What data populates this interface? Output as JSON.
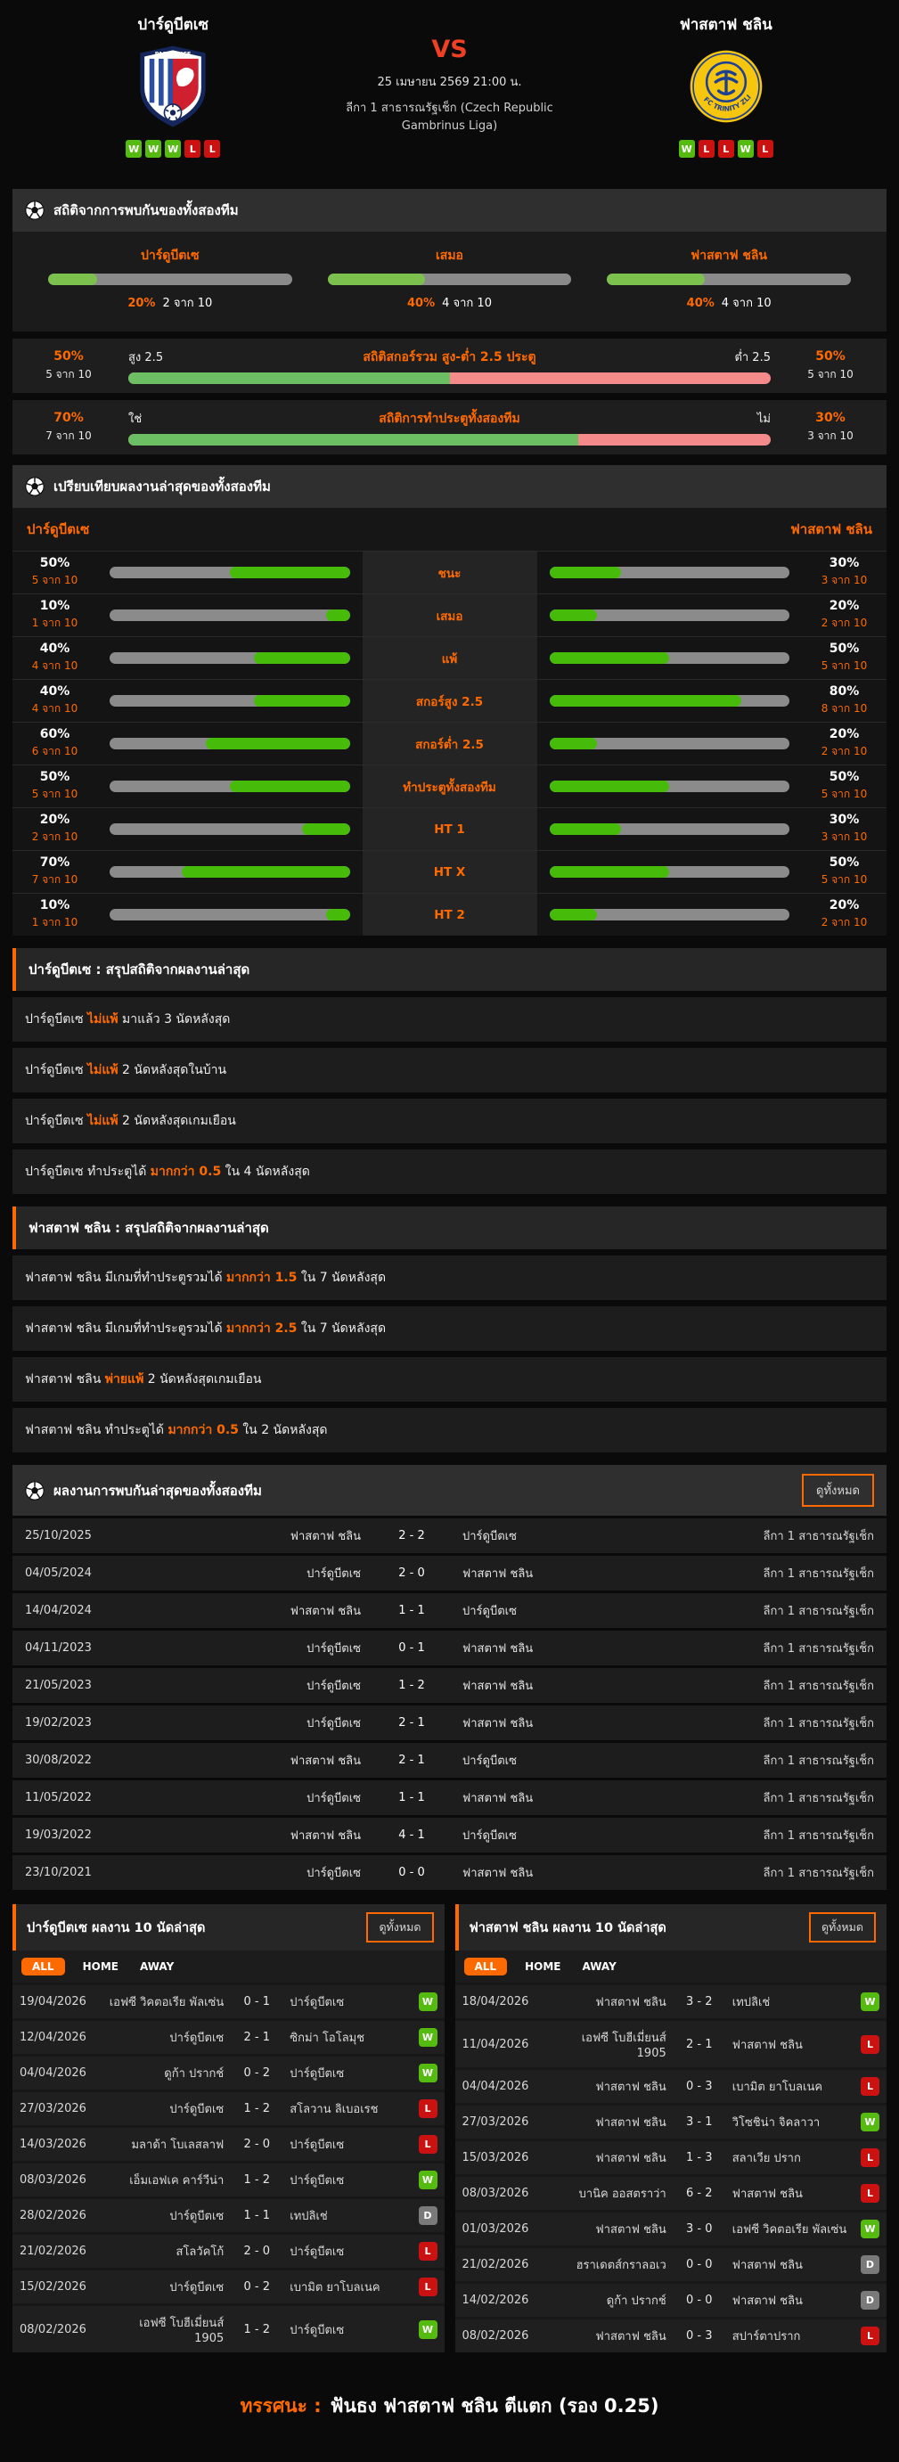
{
  "header": {
    "home": {
      "name": "ปาร์ดูบีตเซ",
      "form": [
        "W",
        "W",
        "W",
        "L",
        "L"
      ]
    },
    "away": {
      "name": "ฟาสตาฟ ชลิน",
      "form": [
        "W",
        "L",
        "L",
        "W",
        "L"
      ]
    },
    "vs": "VS",
    "datetime": "25 เมษายน 2569 21:00 น.",
    "league": "ลีกา 1 สาธารณรัฐเช็ก (Czech Republic Gambrinus Liga)"
  },
  "h2h_stats": {
    "title": "สถิติจากการพบกันของทั้งสองทีม",
    "columns": [
      {
        "label": "ปาร์ดูบีตเซ",
        "percent": 20,
        "count": "2 จาก 10"
      },
      {
        "label": "เสมอ",
        "percent": 40,
        "count": "4 จาก 10"
      },
      {
        "label": "ฟาสตาฟ ชลิน",
        "percent": 40,
        "count": "4 จาก 10"
      }
    ],
    "split_rows": [
      {
        "title": "สถิติสกอร์รวม สูง-ต่ำ 2.5 ประตู",
        "left_label": "สูง 2.5",
        "right_label": "ต่ำ 2.5",
        "left_percent": 50,
        "left_count": "5 จาก 10",
        "right_percent": 50,
        "right_count": "5 จาก 10"
      },
      {
        "title": "สถิติการทำประตูทั้งสองทีม",
        "left_label": "ใช่",
        "right_label": "ไม่",
        "left_percent": 70,
        "left_count": "7 จาก 10",
        "right_percent": 30,
        "right_count": "3 จาก 10"
      }
    ]
  },
  "comparison": {
    "title": "เปรียบเทียบผลงานล่าสุดของทั้งสองทีม",
    "home_label": "ปาร์ดูบีตเซ",
    "away_label": "ฟาสตาฟ ชลิน",
    "rows": [
      {
        "label": "ชนะ",
        "home_percent": 50,
        "home_count": "5 จาก 10",
        "away_percent": 30,
        "away_count": "3 จาก 10"
      },
      {
        "label": "เสมอ",
        "home_percent": 10,
        "home_count": "1 จาก 10",
        "away_percent": 20,
        "away_count": "2 จาก 10"
      },
      {
        "label": "แพ้",
        "home_percent": 40,
        "home_count": "4 จาก 10",
        "away_percent": 50,
        "away_count": "5 จาก 10"
      },
      {
        "label": "สกอร์สูง 2.5",
        "home_percent": 40,
        "home_count": "4 จาก 10",
        "away_percent": 80,
        "away_count": "8 จาก 10"
      },
      {
        "label": "สกอร์ต่ำ 2.5",
        "home_percent": 60,
        "home_count": "6 จาก 10",
        "away_percent": 20,
        "away_count": "2 จาก 10"
      },
      {
        "label": "ทำประตูทั้งสองทีม",
        "home_percent": 50,
        "home_count": "5 จาก 10",
        "away_percent": 50,
        "away_count": "5 จาก 10"
      },
      {
        "label": "HT 1",
        "home_percent": 20,
        "home_count": "2 จาก 10",
        "away_percent": 30,
        "away_count": "3 จาก 10"
      },
      {
        "label": "HT X",
        "home_percent": 70,
        "home_count": "7 จาก 10",
        "away_percent": 50,
        "away_count": "5 จาก 10"
      },
      {
        "label": "HT 2",
        "home_percent": 10,
        "home_count": "1 จาก 10",
        "away_percent": 20,
        "away_count": "2 จาก 10"
      }
    ]
  },
  "home_summary": {
    "title": "ปาร์ดูบีตเซ : สรุปสถิติจากผลงานล่าสุด",
    "rows": [
      {
        "pre": "ปาร์ดูบีตเซ ",
        "hl": "ไม่แพ้",
        "post": " มาแล้ว 3 นัดหลังสุด"
      },
      {
        "pre": "ปาร์ดูบีตเซ ",
        "hl": "ไม่แพ้",
        "post": " 2 นัดหลังสุดในบ้าน"
      },
      {
        "pre": "ปาร์ดูบีตเซ ",
        "hl": "ไม่แพ้",
        "post": " 2 นัดหลังสุดเกมเยือน"
      },
      {
        "pre": "ปาร์ดูบีตเซ ทำประตูได้ ",
        "hl": "มากกว่า 0.5",
        "post": " ใน 4 นัดหลังสุด"
      }
    ]
  },
  "away_summary": {
    "title": "ฟาสตาฟ ชลิน : สรุปสถิติจากผลงานล่าสุด",
    "rows": [
      {
        "pre": "ฟาสตาฟ ชลิน มีเกมที่ทำประตูรวมได้ ",
        "hl": "มากกว่า 1.5",
        "post": " ใน 7 นัดหลังสุด"
      },
      {
        "pre": "ฟาสตาฟ ชลิน มีเกมที่ทำประตูรวมได้ ",
        "hl": "มากกว่า 2.5",
        "post": " ใน 7 นัดหลังสุด"
      },
      {
        "pre": "ฟาสตาฟ ชลิน ",
        "hl": "พ่ายแพ้",
        "post": " 2 นัดหลังสุดเกมเยือน"
      },
      {
        "pre": "ฟาสตาฟ ชลิน ทำประตูได้ ",
        "hl": "มากกว่า 0.5",
        "post": " ใน 2 นัดหลังสุด"
      }
    ]
  },
  "h2h_matches": {
    "title": "ผลงานการพบกันล่าสุดของทั้งสองทีม",
    "view_all": "ดูทั้งหมด",
    "rows": [
      {
        "date": "25/10/2025",
        "home": "ฟาสตาฟ ชลิน",
        "score": "2 - 2",
        "away": "ปาร์ดูบีตเซ",
        "league": "ลีกา 1 สาธารณรัฐเช็ก"
      },
      {
        "date": "04/05/2024",
        "home": "ปาร์ดูบีตเซ",
        "score": "2 - 0",
        "away": "ฟาสตาฟ ชลิน",
        "league": "ลีกา 1 สาธารณรัฐเช็ก"
      },
      {
        "date": "14/04/2024",
        "home": "ฟาสตาฟ ชลิน",
        "score": "1 - 1",
        "away": "ปาร์ดูบีตเซ",
        "league": "ลีกา 1 สาธารณรัฐเช็ก"
      },
      {
        "date": "04/11/2023",
        "home": "ปาร์ดูบีตเซ",
        "score": "0 - 1",
        "away": "ฟาสตาฟ ชลิน",
        "league": "ลีกา 1 สาธารณรัฐเช็ก"
      },
      {
        "date": "21/05/2023",
        "home": "ปาร์ดูบีตเซ",
        "score": "1 - 2",
        "away": "ฟาสตาฟ ชลิน",
        "league": "ลีกา 1 สาธารณรัฐเช็ก"
      },
      {
        "date": "19/02/2023",
        "home": "ปาร์ดูบีตเซ",
        "score": "2 - 1",
        "away": "ฟาสตาฟ ชลิน",
        "league": "ลีกา 1 สาธารณรัฐเช็ก"
      },
      {
        "date": "30/08/2022",
        "home": "ฟาสตาฟ ชลิน",
        "score": "2 - 1",
        "away": "ปาร์ดูบีตเซ",
        "league": "ลีกา 1 สาธารณรัฐเช็ก"
      },
      {
        "date": "11/05/2022",
        "home": "ปาร์ดูบีตเซ",
        "score": "1 - 1",
        "away": "ฟาสตาฟ ชลิน",
        "league": "ลีกา 1 สาธารณรัฐเช็ก"
      },
      {
        "date": "19/03/2022",
        "home": "ฟาสตาฟ ชลิน",
        "score": "4 - 1",
        "away": "ปาร์ดูบีตเซ",
        "league": "ลีกา 1 สาธารณรัฐเช็ก"
      },
      {
        "date": "23/10/2021",
        "home": "ปาร์ดูบีตเซ",
        "score": "0 - 0",
        "away": "ฟาสตาฟ ชลิน",
        "league": "ลีกา 1 สาธารณรัฐเช็ก"
      }
    ]
  },
  "recent_panels": [
    {
      "title": "ปาร์ดูบีตเซ ผลงาน 10 นัดล่าสุด",
      "view_all": "ดูทั้งหมด",
      "tabs": [
        "ALL",
        "HOME",
        "AWAY"
      ],
      "active_tab": "ALL",
      "rows": [
        {
          "date": "19/04/2026",
          "home": "เอฟซี วิคตอเรีย พัลเซ่น",
          "score": "0 - 1",
          "away": "ปาร์ดูบีตเซ",
          "result": "W"
        },
        {
          "date": "12/04/2026",
          "home": "ปาร์ดูบีตเซ",
          "score": "2 - 1",
          "away": "ซิกม่า โอโลมุช",
          "result": "W"
        },
        {
          "date": "04/04/2026",
          "home": "ดูก้า ปรากช์",
          "score": "0 - 2",
          "away": "ปาร์ดูบีตเซ",
          "result": "W"
        },
        {
          "date": "27/03/2026",
          "home": "ปาร์ดูบีตเซ",
          "score": "1 - 2",
          "away": "สโลวาน ลิเบอเรช",
          "result": "L"
        },
        {
          "date": "14/03/2026",
          "home": "มลาด้า โบเลสลาฟ",
          "score": "2 - 0",
          "away": "ปาร์ดูบีตเซ",
          "result": "L"
        },
        {
          "date": "08/03/2026",
          "home": "เอ็มเอฟเค คาร์วีน่า",
          "score": "1 - 2",
          "away": "ปาร์ดูบีตเซ",
          "result": "W"
        },
        {
          "date": "28/02/2026",
          "home": "ปาร์ดูบีตเซ",
          "score": "1 - 1",
          "away": "เทปลิเช่",
          "result": "D"
        },
        {
          "date": "21/02/2026",
          "home": "สโลวัคโก้",
          "score": "2 - 0",
          "away": "ปาร์ดูบีตเซ",
          "result": "L"
        },
        {
          "date": "15/02/2026",
          "home": "ปาร์ดูบีตเซ",
          "score": "0 - 2",
          "away": "เบามิต ยาโบลเนค",
          "result": "L"
        },
        {
          "date": "08/02/2026",
          "home": "เอฟซี โบฮีเมี่ยนส์ 1905",
          "score": "1 - 2",
          "away": "ปาร์ดูบีตเซ",
          "result": "W"
        }
      ]
    },
    {
      "title": "ฟาสตาฟ ชลิน ผลงาน 10 นัดล่าสุด",
      "view_all": "ดูทั้งหมด",
      "tabs": [
        "ALL",
        "HOME",
        "AWAY"
      ],
      "active_tab": "ALL",
      "rows": [
        {
          "date": "18/04/2026",
          "home": "ฟาสตาฟ ชลิน",
          "score": "3 - 2",
          "away": "เทปลิเช่",
          "result": "W"
        },
        {
          "date": "11/04/2026",
          "home": "เอฟซี โบฮีเมี่ยนส์ 1905",
          "score": "2 - 1",
          "away": "ฟาสตาฟ ชลิน",
          "result": "L"
        },
        {
          "date": "04/04/2026",
          "home": "ฟาสตาฟ ชลิน",
          "score": "0 - 3",
          "away": "เบามิต ยาโบลเนค",
          "result": "L"
        },
        {
          "date": "27/03/2026",
          "home": "ฟาสตาฟ ชลิน",
          "score": "3 - 1",
          "away": "วิโซชิน่า จิคลาวา",
          "result": "W"
        },
        {
          "date": "15/03/2026",
          "home": "ฟาสตาฟ ชลิน",
          "score": "1 - 3",
          "away": "สลาเวีย ปราก",
          "result": "L"
        },
        {
          "date": "08/03/2026",
          "home": "บานิค ออสตราว่า",
          "score": "6 - 2",
          "away": "ฟาสตาฟ ชลิน",
          "result": "L"
        },
        {
          "date": "01/03/2026",
          "home": "ฟาสตาฟ ชลิน",
          "score": "3 - 0",
          "away": "เอฟซี วิคตอเรีย พัลเซ่น",
          "result": "W"
        },
        {
          "date": "21/02/2026",
          "home": "ฮราเดตส์กราลอเว",
          "score": "0 - 0",
          "away": "ฟาสตาฟ ชลิน",
          "result": "D"
        },
        {
          "date": "14/02/2026",
          "home": "ดูก้า ปรากช์",
          "score": "0 - 0",
          "away": "ฟาสตาฟ ชลิน",
          "result": "D"
        },
        {
          "date": "08/02/2026",
          "home": "ฟาสตาฟ ชลิน",
          "score": "0 - 3",
          "away": "สปาร์ตาปราก",
          "result": "L"
        }
      ]
    }
  ],
  "footer": {
    "label": "ทรรศนะ :",
    "text": "ฟันธง ฟาสตาฟ ชลิน ตีแตก (รอง 0.25)"
  },
  "colors": {
    "accent": "#ff6a00",
    "vs": "#ef4023",
    "bar_green": "#7cc14e",
    "bar_pink": "#f48a8a",
    "bar_grey": "#8a8a8a",
    "cmp_green": "#47bb0a",
    "win": "#55bb11",
    "lose": "#cc1111",
    "draw": "#7a7a7a"
  }
}
